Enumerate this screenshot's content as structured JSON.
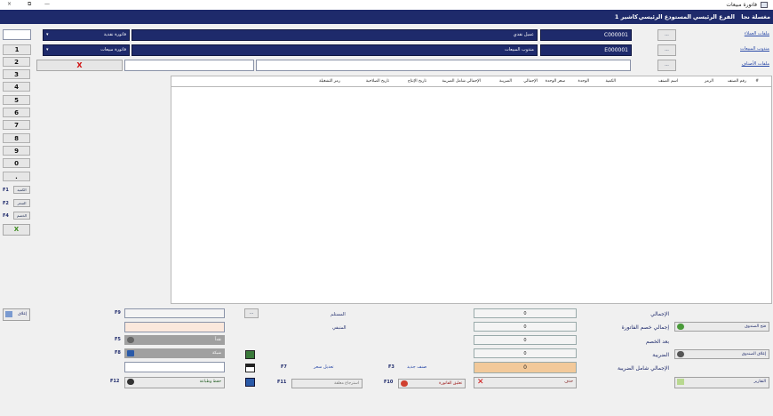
{
  "window": {
    "title": "فاتورة مبيعات",
    "close": "×",
    "restore": "⧉",
    "minimize": "—"
  },
  "menu": {
    "company": "مغسلة نجا",
    "branch": "الفرع الرئيسي",
    "warehouse": "المستودع الرئيسي",
    "cashier": "كاشير 1"
  },
  "header": {
    "customers_link": "ملفات العملاء",
    "sales_rep_link": "مندوب المبيعات",
    "items_link": "ملفات الأصناف",
    "customer_code": "C000001",
    "customer_name": "عميل نقدي",
    "rep_code": "E000001",
    "rep_name": "مندوب المبيعات",
    "invoice_type": "فاتورة نقدية",
    "doc_type": "فاتورة مبيعات",
    "ellipsis": "...",
    "clear_x": "X",
    "arrow": "▾"
  },
  "keypad": {
    "keys": [
      "1",
      "2",
      "3",
      "4",
      "5",
      "6",
      "7",
      "8",
      "9",
      "0",
      "."
    ],
    "qty_label": "الكمية",
    "price_label": "السعر",
    "disc_label": "الخصم",
    "f1": "F1",
    "f2": "F2",
    "f4": "F4",
    "check": "X"
  },
  "grid": {
    "columns": [
      "#",
      "رقم الصنف",
      "الرمز",
      "اسم الصنف",
      "الكمية",
      "الوحدة",
      "سعر الوحدة",
      "الإجمالي",
      "الضريبة",
      "الإجمالي شامل الضريبة",
      "تاريخ الإنتاج",
      "تاريخ الصلاحية",
      "رمز التشغيلة"
    ]
  },
  "totals": {
    "total_label": "الإجمالي",
    "discount_label": "إجمالي خصم الفاتورة",
    "after_discount_label": "بعد الخصم",
    "tax_label": "الضريبة",
    "grand_label": "الإجمالي شامل الضريبة",
    "total": "0",
    "discount": "0",
    "after_discount": "0",
    "tax": "0",
    "grand": "0",
    "open_drawer": "فتح الصندوق",
    "close_drawer": "إغلاق الصندوق",
    "reports": "التقارير"
  },
  "payment": {
    "received_label": "المستلم",
    "remaining_label": "المتبقي",
    "ellipsis": "...",
    "cash": "نقداً",
    "network": "شبكة",
    "save_print": "حفظ وطباعة",
    "f9": "F9",
    "f5": "F5",
    "f8": "F8",
    "f12": "F12"
  },
  "actions": {
    "new_item": "صنف جديد",
    "new_item_key": "F3",
    "price_edit": "تعديل سعر",
    "price_edit_key": "F7",
    "delete": "حذف",
    "hold_invoice": "تعليق الفاتورة",
    "hold_key": "F10",
    "recall": "استرجاع معلقة",
    "recall_key": "F11",
    "close": "إغلاق"
  }
}
